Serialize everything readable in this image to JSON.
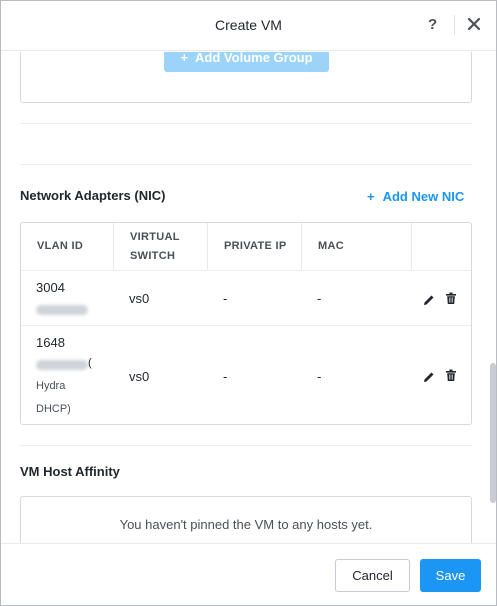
{
  "dialog": {
    "title": "Create VM",
    "help_label": "?"
  },
  "volume_group": {
    "add_label": "Add Volume Group",
    "add_icon": "+"
  },
  "network": {
    "section_title": "Network Adapters (NIC)",
    "add_icon": "+",
    "add_label": "Add New NIC",
    "columns": [
      "VLAN ID",
      "VIRTUAL",
      "SWITCH",
      "PRIVATE IP",
      "MAC"
    ],
    "rows": [
      {
        "vlan_id": "3004",
        "vlan_sub": "",
        "virtual_switch": "vs0",
        "private_ip": "-",
        "mac": "-"
      },
      {
        "vlan_id": "1648",
        "vlan_paren": "(",
        "vlan_sub_1": "Hydra",
        "vlan_sub_2": "DHCP)",
        "virtual_switch": "vs0",
        "private_ip": "-",
        "mac": "-"
      }
    ]
  },
  "host_affinity": {
    "section_title": "VM Host Affinity",
    "empty_message": "You haven't pinned the VM to any hosts yet."
  },
  "footer": {
    "cancel_label": "Cancel",
    "save_label": "Save"
  },
  "colors": {
    "accent": "#1b96f2",
    "accent_disabled": "#9cd3f8",
    "border": "#d6dadf",
    "text": "#22272e"
  }
}
